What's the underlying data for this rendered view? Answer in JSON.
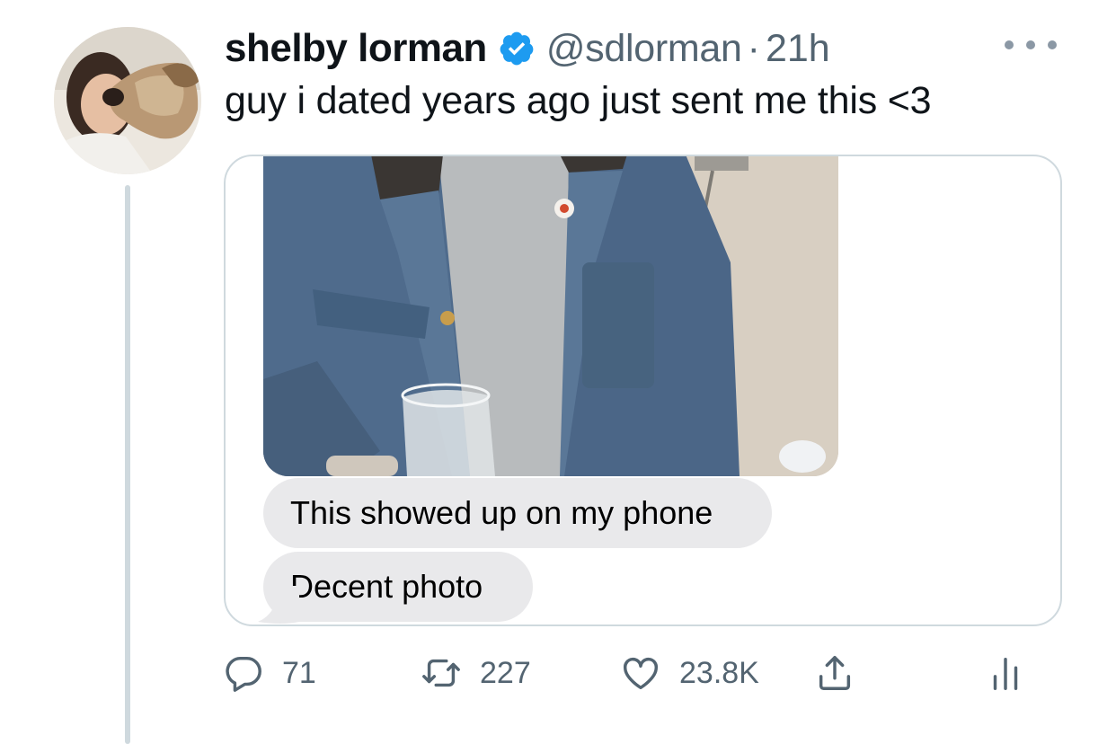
{
  "tweet": {
    "display_name": "shelby lorman",
    "handle": "@sdlorman",
    "separator": "·",
    "time": "21h",
    "text": "guy i dated years ago just sent me this <3"
  },
  "messages": [
    {
      "text": "This showed up on my phone"
    },
    {
      "text": "Decent photo"
    }
  ],
  "actions": {
    "replies": "71",
    "retweets": "227",
    "likes": "23.8K"
  },
  "icons": {
    "verified": "verified-badge-icon",
    "more": "more-options-icon",
    "reply": "reply-icon",
    "retweet": "retweet-icon",
    "like": "heart-icon",
    "share": "share-icon",
    "stats": "analytics-icon"
  },
  "colors": {
    "verified": "#1d9bf0",
    "secondary_text": "#536471",
    "imessage_bubble": "#e9e9eb",
    "jacket": "#4f6b8c",
    "sweater": "#b8bbbd"
  }
}
